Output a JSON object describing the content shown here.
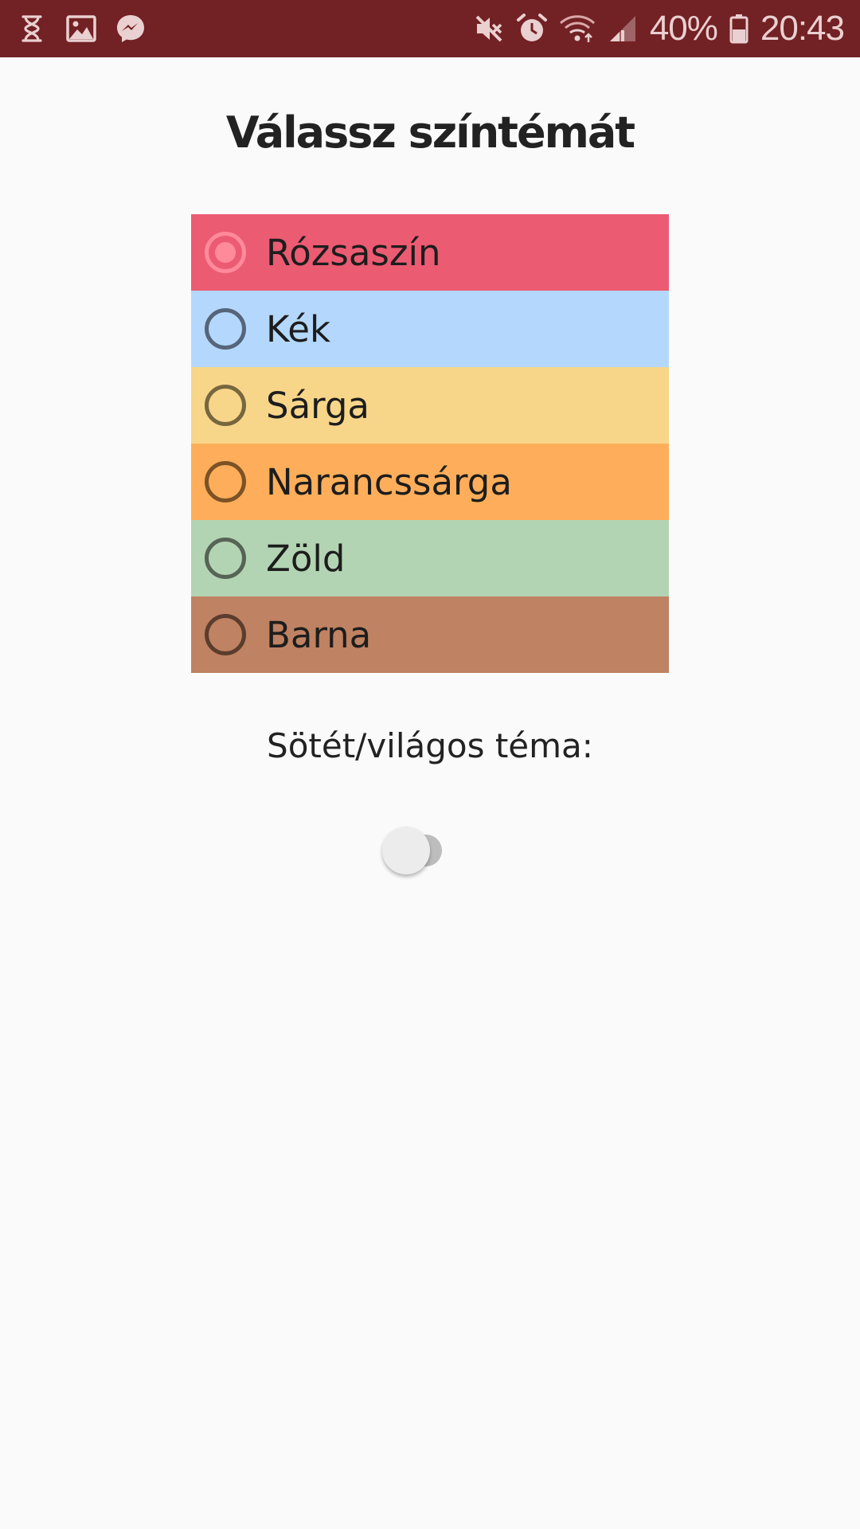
{
  "status_bar": {
    "icons_left": [
      "hourglass-icon",
      "image-icon",
      "messenger-icon"
    ],
    "icons_right": [
      "mute-icon",
      "alarm-icon",
      "wifi-icon",
      "signal-icon"
    ],
    "battery": "40%",
    "time": "20:43",
    "color": "#722124"
  },
  "page": {
    "title": "Válassz színtémát",
    "dark_mode_label": "Sötét/világos téma:"
  },
  "themes": [
    {
      "label": "Rózsaszín",
      "color": "#eb5b72",
      "ring": "#ff8a9a",
      "selected": true
    },
    {
      "label": "Kék",
      "color": "#b4d8fd",
      "ring": "#56657a",
      "selected": false
    },
    {
      "label": "Sárga",
      "color": "#f7d68a",
      "ring": "#77673f",
      "selected": false
    },
    {
      "label": "Narancssárga",
      "color": "#feae5a",
      "ring": "#7c5226",
      "selected": false
    },
    {
      "label": "Zöld",
      "color": "#b3d4b3",
      "ring": "#566456",
      "selected": false
    },
    {
      "label": "Barna",
      "color": "#bf8262",
      "ring": "#5a3d2d",
      "selected": false
    }
  ],
  "dark_mode_switch": {
    "on": false
  }
}
